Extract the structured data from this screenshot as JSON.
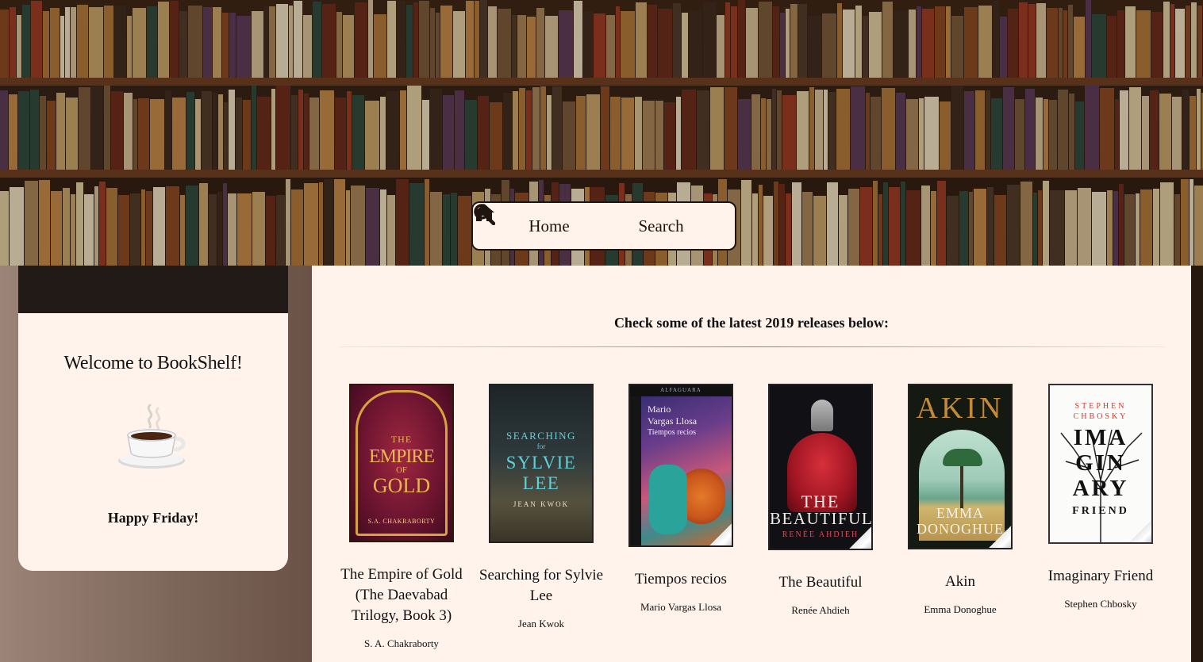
{
  "nav": {
    "home_label": "Home",
    "search_label": "Search"
  },
  "welcome": {
    "title": "Welcome to BookShelf!",
    "greeting": "Happy Friday!",
    "icon": "coffee-cup-icon"
  },
  "main": {
    "heading": "Check some of the latest 2019 releases below:",
    "books": [
      {
        "title": "The Empire of Gold (The Daevabad Trilogy, Book 3)",
        "author": "S. A. Chakraborty",
        "cover": {
          "line1": "THE",
          "line2": "EMPIRE",
          "line3": "OF",
          "line4": "GOLD",
          "byline": "S.A. CHAKRABORTY"
        }
      },
      {
        "title": "Searching for Sylvie Lee",
        "author": "Jean Kwok",
        "cover": {
          "line1": "SEARCHING",
          "line2": "for",
          "line3": "SYLVIE",
          "line4": "LEE",
          "byline": "JEAN KWOK"
        }
      },
      {
        "title": "Tiempos recios",
        "author": "Mario Vargas Llosa",
        "cover": {
          "line1": "Mario",
          "line2": "Vargas Llosa",
          "line3": "Tiempos recios",
          "publisher": "ALFAGUARA"
        }
      },
      {
        "title": "The Beautiful",
        "author": "Renée Ahdieh",
        "cover": {
          "line1": "THE",
          "line2": "BEAUTIFUL",
          "byline": "RENÉE AHDIEH"
        }
      },
      {
        "title": "Akin",
        "author": "Emma Donoghue",
        "cover": {
          "line1": "AKIN",
          "line2": "EMMA",
          "line3": "DONOGHUE"
        }
      },
      {
        "title": "Imaginary Friend",
        "author": "Stephen Chbosky",
        "cover": {
          "line1": "STEPHEN",
          "line2": "CHBOSKY",
          "line3": "IMA",
          "line4": "GIN",
          "line5": "ARY",
          "line6": "FRIEND"
        }
      }
    ]
  }
}
